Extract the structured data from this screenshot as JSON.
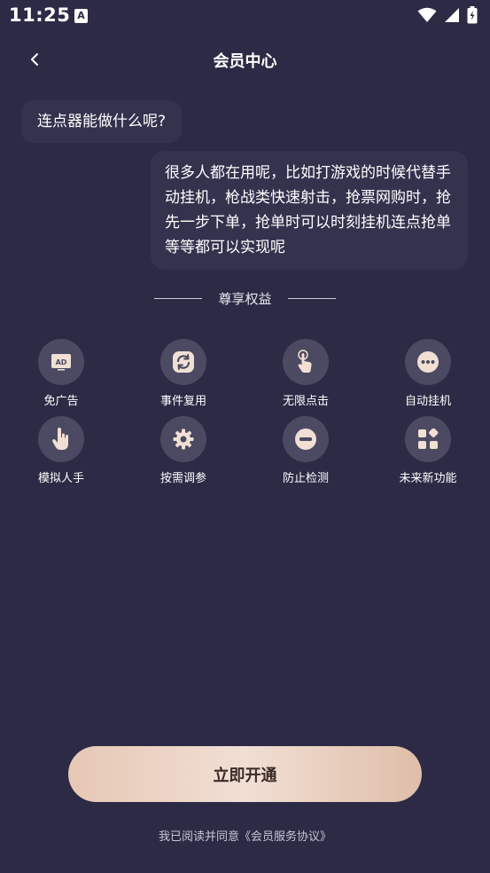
{
  "status_bar": {
    "time": "11:25",
    "notification_icon": "A",
    "icons": [
      "wifi-icon",
      "signal-icon",
      "battery-charging-icon"
    ]
  },
  "header": {
    "title": "会员中心",
    "back_icon": "chevron-left-icon"
  },
  "chat": {
    "question": "连点器能做什么呢?",
    "answer": "很多人都在用呢，比如打游戏的时候代替手动挂机，枪战类快速射击，抢票网购时，抢先一步下单，抢单时可以时刻挂机连点抢单等等都可以实现呢"
  },
  "benefits_section": {
    "title": "尊享权益",
    "items": [
      {
        "label": "免广告",
        "icon": "ad-icon"
      },
      {
        "label": "事件复用",
        "icon": "refresh-icon"
      },
      {
        "label": "无限点击",
        "icon": "tap-icon"
      },
      {
        "label": "自动挂机",
        "icon": "more-icon"
      },
      {
        "label": "模拟人手",
        "icon": "hand-icon"
      },
      {
        "label": "按需调参",
        "icon": "gear-icon"
      },
      {
        "label": "防止检测",
        "icon": "block-icon"
      },
      {
        "label": "未来新功能",
        "icon": "apps-icon"
      }
    ]
  },
  "cta": {
    "label": "立即开通"
  },
  "footer": {
    "agreement": "我已阅读并同意《会员服务协议》"
  },
  "colors": {
    "background": "#2c2a45",
    "bubble": "#34324d",
    "icon_circle": "#4b4a62",
    "accent": "#e6c7b5"
  }
}
